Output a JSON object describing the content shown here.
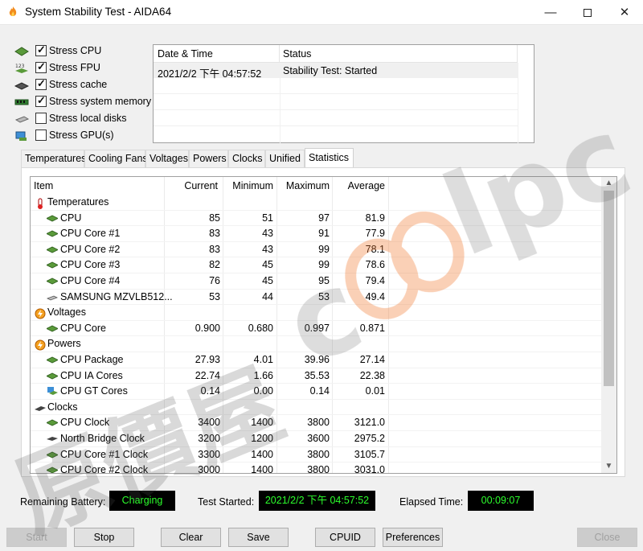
{
  "window": {
    "title": "System Stability Test - AIDA64",
    "minimize_glyph": "—",
    "close_glyph": "✕"
  },
  "stress_options": [
    {
      "label": "Stress CPU",
      "checked": true,
      "icon": "cpu-chip-icon"
    },
    {
      "label": "Stress FPU",
      "checked": true,
      "icon": "fpu-123-icon"
    },
    {
      "label": "Stress cache",
      "checked": true,
      "icon": "cache-chip-icon"
    },
    {
      "label": "Stress system memory",
      "checked": true,
      "icon": "memory-module-icon"
    },
    {
      "label": "Stress local disks",
      "checked": false,
      "icon": "disk-drive-icon"
    },
    {
      "label": "Stress GPU(s)",
      "checked": false,
      "icon": "gpu-monitor-icon"
    }
  ],
  "log": {
    "headers": [
      "Date & Time",
      "Status"
    ],
    "rows": [
      {
        "datetime": "2021/2/2 下午 04:57:52",
        "status": "Stability Test: Started"
      }
    ]
  },
  "tabs": [
    "Temperatures",
    "Cooling Fans",
    "Voltages",
    "Powers",
    "Clocks",
    "Unified",
    "Statistics"
  ],
  "active_tab": "Statistics",
  "stats": {
    "headers": {
      "item": "Item",
      "current": "Current",
      "minimum": "Minimum",
      "maximum": "Maximum",
      "average": "Average"
    },
    "rows": [
      {
        "group": true,
        "name": "Temperatures",
        "icon": "thermometer-icon"
      },
      {
        "name": "CPU",
        "icon": "chip-icon",
        "current": "85",
        "minimum": "51",
        "maximum": "97",
        "average": "81.9"
      },
      {
        "name": "CPU Core #1",
        "icon": "chip-icon",
        "current": "83",
        "minimum": "43",
        "maximum": "91",
        "average": "77.9"
      },
      {
        "name": "CPU Core #2",
        "icon": "chip-icon",
        "current": "83",
        "minimum": "43",
        "maximum": "99",
        "average": "78.1"
      },
      {
        "name": "CPU Core #3",
        "icon": "chip-icon",
        "current": "82",
        "minimum": "45",
        "maximum": "99",
        "average": "78.6"
      },
      {
        "name": "CPU Core #4",
        "icon": "chip-icon",
        "current": "76",
        "minimum": "45",
        "maximum": "95",
        "average": "79.4"
      },
      {
        "name": "SAMSUNG MZVLB512...",
        "icon": "disk-icon",
        "current": "53",
        "minimum": "44",
        "maximum": "53",
        "average": "49.4"
      },
      {
        "group": true,
        "name": "Voltages",
        "icon": "bolt-icon"
      },
      {
        "name": "CPU Core",
        "icon": "chip-icon",
        "current": "0.900",
        "minimum": "0.680",
        "maximum": "0.997",
        "average": "0.871"
      },
      {
        "group": true,
        "name": "Powers",
        "icon": "bolt-icon"
      },
      {
        "name": "CPU Package",
        "icon": "chip-icon",
        "current": "27.93",
        "minimum": "4.01",
        "maximum": "39.96",
        "average": "27.14"
      },
      {
        "name": "CPU IA Cores",
        "icon": "chip-icon",
        "current": "22.74",
        "minimum": "1.66",
        "maximum": "35.53",
        "average": "22.38"
      },
      {
        "name": "CPU GT Cores",
        "icon": "gpu-icon",
        "current": "0.14",
        "minimum": "0.00",
        "maximum": "0.14",
        "average": "0.01"
      },
      {
        "group": true,
        "name": "Clocks",
        "icon": "clock-board-icon"
      },
      {
        "name": "CPU Clock",
        "icon": "chip-icon",
        "current": "3400",
        "minimum": "1400",
        "maximum": "3800",
        "average": "3121.0"
      },
      {
        "name": "North Bridge Clock",
        "icon": "board-icon",
        "current": "3200",
        "minimum": "1200",
        "maximum": "3600",
        "average": "2975.2"
      },
      {
        "name": "CPU Core #1 Clock",
        "icon": "chip-icon",
        "current": "3300",
        "minimum": "1400",
        "maximum": "3800",
        "average": "3105.7"
      },
      {
        "name": "CPU Core #2 Clock",
        "icon": "chip-icon",
        "current": "3000",
        "minimum": "1400",
        "maximum": "3800",
        "average": "3031.0"
      }
    ]
  },
  "status_bar": {
    "battery_label": "Remaining Battery:",
    "battery_value": "Charging",
    "started_label": "Test Started:",
    "started_value": "2021/2/2 下午 04:57:52",
    "elapsed_label": "Elapsed Time:",
    "elapsed_value": "00:09:07"
  },
  "buttons": {
    "start": "Start",
    "stop": "Stop",
    "clear": "Clear",
    "save": "Save",
    "cpuid": "CPUID",
    "preferences": "Preferences",
    "close": "Close"
  },
  "colors": {
    "led_background": "#000000",
    "led_text": "#2cff2c",
    "chip_icon": "#3a7a2a"
  }
}
